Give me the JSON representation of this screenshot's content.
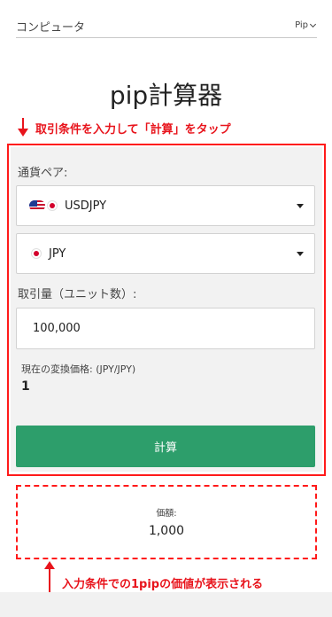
{
  "nav": {
    "category": "コンピュータ",
    "pip_menu": "Pip"
  },
  "title": "pip計算器",
  "annotations": {
    "top": "取引条件を入力して「計算」をタップ",
    "bottom": "入力条件での1pipの価値が表示される",
    "color": "#e8141c"
  },
  "form": {
    "pair_label": "通貨ペア:",
    "pair_value": "USDJPY",
    "currency_value": "JPY",
    "amount_label": "取引量（ユニット数）:",
    "amount_value": "100,000",
    "rate_label": "現在の変換価格: (JPY/JPY)",
    "rate_value": "1",
    "calc_button": "計算",
    "button_color": "#2d9e6b"
  },
  "result": {
    "label": "価額:",
    "value": "1,000"
  },
  "icons": [
    "chevron-down-icon",
    "us-flag-icon",
    "japan-flag-icon",
    "dropdown-caret-icon",
    "arrow-down-icon",
    "arrow-up-icon"
  ]
}
